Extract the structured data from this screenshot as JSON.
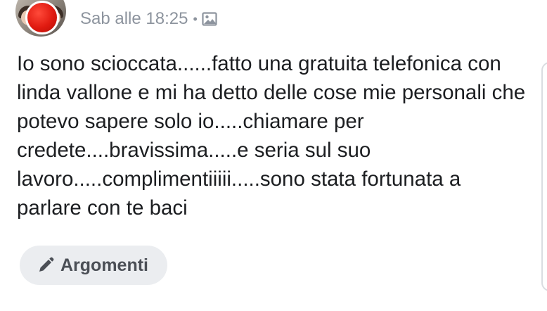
{
  "post": {
    "author_name": "",
    "timestamp": "Sab alle 18:25",
    "separator": "•",
    "privacy_icon": "image-icon",
    "text": "Io sono scioccata......fatto una gratuita telefonica con linda vallone e mi ha detto delle cose mie personali che potevo sapere solo io.....chiamare per credete....bravissima.....e seria sul suo lavoro.....complimentiiiii.....sono stata fortunata a parlare con te baci",
    "topic_button": {
      "label": "Argomenti",
      "icon": "pencil-icon"
    }
  },
  "colors": {
    "text": "#1c1e21",
    "meta": "#8d949e",
    "button_bg": "#ebedf0",
    "button_text": "#4b4f56",
    "presence_dot": "#e01a10"
  }
}
